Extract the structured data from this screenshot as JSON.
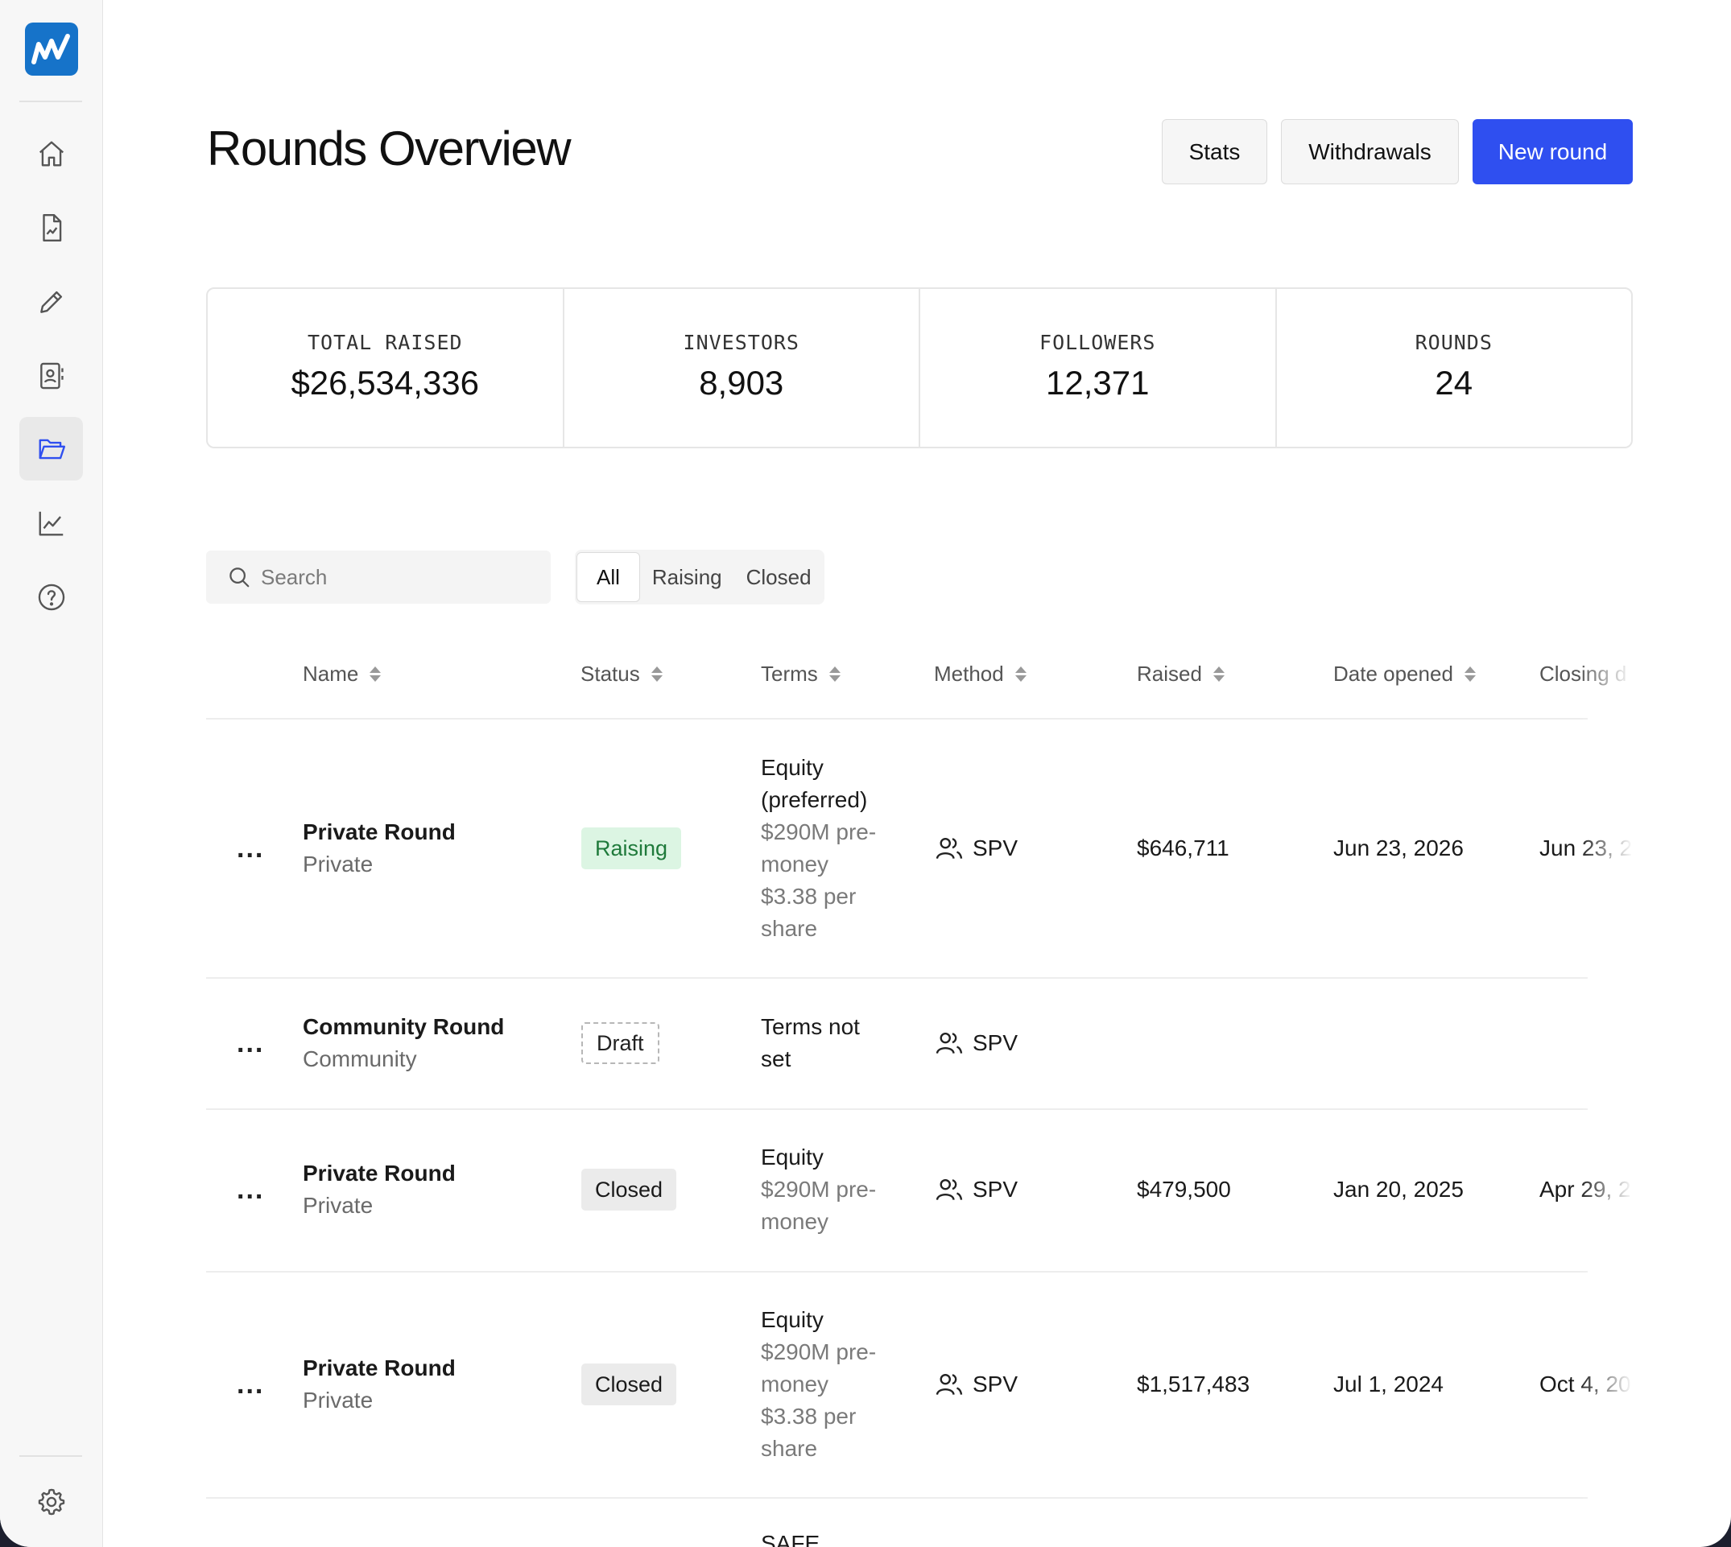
{
  "header": {
    "title": "Rounds Overview",
    "buttons": {
      "stats": "Stats",
      "withdrawals": "Withdrawals",
      "new_round": "New round"
    }
  },
  "stats": [
    {
      "label": "TOTAL RAISED",
      "value": "$26,534,336"
    },
    {
      "label": "INVESTORS",
      "value": "8,903"
    },
    {
      "label": "FOLLOWERS",
      "value": "12,371"
    },
    {
      "label": "ROUNDS",
      "value": "24"
    }
  ],
  "search": {
    "placeholder": "Search"
  },
  "filters": {
    "all": "All",
    "raising": "Raising",
    "closed": "Closed",
    "selected": "All"
  },
  "columns": {
    "name": "Name",
    "status": "Status",
    "terms": "Terms",
    "method": "Method",
    "raised": "Raised",
    "date_opened": "Date opened",
    "closing": "Closing d"
  },
  "rows": [
    {
      "actions": "...",
      "name": "Private Round",
      "type": "Private",
      "status": "Raising",
      "terms": [
        "Equity",
        "(preferred)"
      ],
      "terms_detail": [
        "$290M pre-",
        "money",
        "$3.38 per",
        "share"
      ],
      "method": "SPV",
      "raised": "$646,711",
      "date_opened": "Jun 23, 2026",
      "closing": "Jun 23, 2"
    },
    {
      "actions": "...",
      "name": "Community Round",
      "type": "Community",
      "status": "Draft",
      "terms": [
        "Terms not",
        "set"
      ],
      "terms_detail": [],
      "method": "SPV",
      "raised": "",
      "date_opened": "",
      "closing": ""
    },
    {
      "actions": "...",
      "name": "Private Round",
      "type": "Private",
      "status": "Closed",
      "terms": [
        "Equity"
      ],
      "terms_detail": [
        "$290M pre-",
        "money"
      ],
      "method": "SPV",
      "raised": "$479,500",
      "date_opened": "Jan 20, 2025",
      "closing": "Apr 29, 2"
    },
    {
      "actions": "...",
      "name": "Private Round",
      "type": "Private",
      "status": "Closed",
      "terms": [
        "Equity"
      ],
      "terms_detail": [
        "$290M pre-",
        "money",
        "$3.38 per",
        "share"
      ],
      "method": "SPV",
      "raised": "$1,517,483",
      "date_opened": "Jul 1, 2024",
      "closing": "Oct 4, 20"
    },
    {
      "terms": [
        "SAFE"
      ]
    }
  ],
  "sidebar": {
    "logo": "w-logo",
    "items": [
      {
        "icon": "home-icon"
      },
      {
        "icon": "document-chart-icon"
      },
      {
        "icon": "pencil-icon"
      },
      {
        "icon": "contact-book-icon"
      },
      {
        "icon": "folder-open-icon",
        "active": true
      },
      {
        "icon": "line-chart-icon"
      },
      {
        "icon": "help-circle-icon"
      }
    ],
    "bottom": {
      "icon": "gear-icon"
    }
  },
  "colors": {
    "accent": "#2f4ff0",
    "logo": "#1673c9",
    "raising_bg": "#dcf5e3",
    "raising_text": "#1f7a3b",
    "closed_bg": "#ebebeb"
  }
}
